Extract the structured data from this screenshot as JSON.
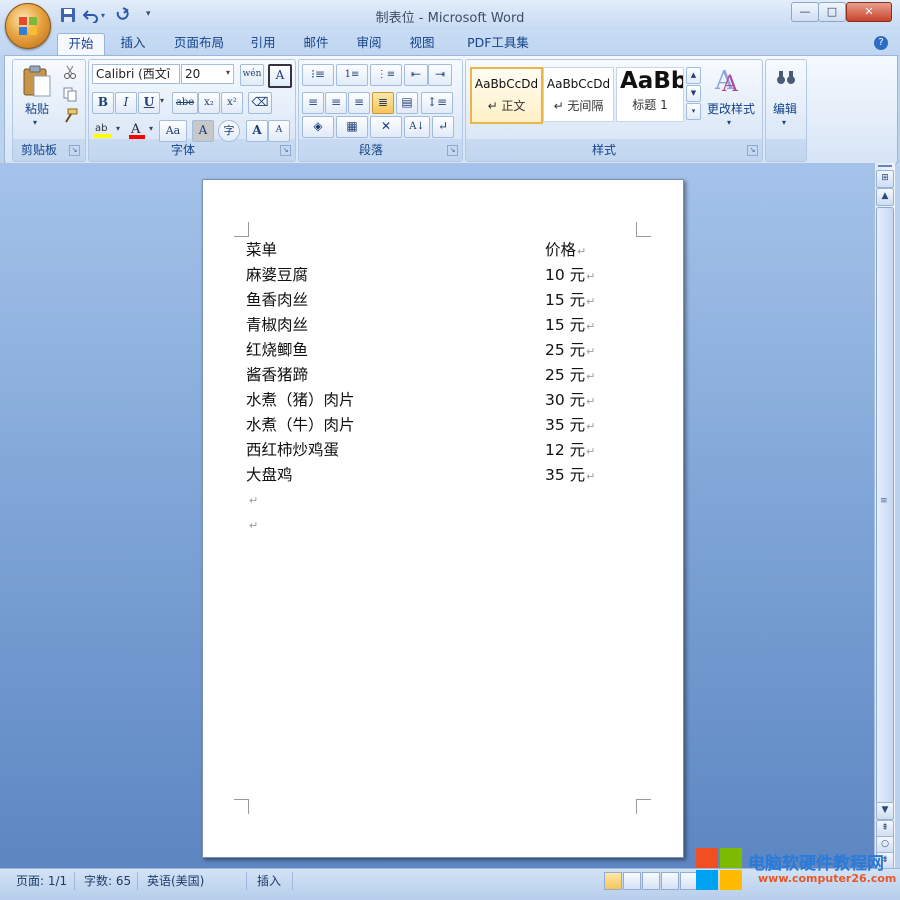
{
  "window": {
    "title": "制表位 - Microsoft Word",
    "minimize": "—",
    "maximize": "□",
    "close": "✕"
  },
  "tabs": [
    "开始",
    "插入",
    "页面布局",
    "引用",
    "邮件",
    "审阅",
    "视图",
    "PDF工具集"
  ],
  "ribbon": {
    "clipboard": {
      "label": "剪贴板",
      "paste": "粘贴"
    },
    "font": {
      "label": "字体",
      "font_name": "Calibri (西文ī",
      "font_size": "20",
      "bold": "B",
      "italic": "I",
      "underline": "U",
      "strike": "abe",
      "subscript": "x₂",
      "superscript": "x²",
      "grow": "A",
      "shrink": "A",
      "case": "Aa",
      "phonetic": "wén",
      "char_border": "A",
      "char_shade": "A",
      "enclose": "字"
    },
    "paragraph": {
      "label": "段落"
    },
    "styles": {
      "label": "样式",
      "items": [
        {
          "sample": "AaBbCcDd",
          "name": "↵ 正文"
        },
        {
          "sample": "AaBbCcDd",
          "name": "↵ 无间隔"
        },
        {
          "sample": "AaBb",
          "name": "标题 1"
        }
      ],
      "change_styles": "更改样式"
    },
    "editing": {
      "label": "编辑"
    }
  },
  "document": {
    "paragraph_mark": "↵",
    "rows": [
      {
        "item": "菜单",
        "price": "价格"
      },
      {
        "item": "麻婆豆腐",
        "price": "10 元"
      },
      {
        "item": "鱼香肉丝",
        "price": "15 元"
      },
      {
        "item": "青椒肉丝",
        "price": "15 元"
      },
      {
        "item": "红烧鲫鱼",
        "price": "25 元"
      },
      {
        "item": "酱香猪蹄",
        "price": "25 元"
      },
      {
        "item": "水煮（猪）肉片",
        "price": "30 元"
      },
      {
        "item": "水煮（牛）肉片",
        "price": "35 元"
      },
      {
        "item": "西红柿炒鸡蛋",
        "price": "12 元"
      },
      {
        "item": "大盘鸡",
        "price": "35 元"
      }
    ]
  },
  "status": {
    "page": "页面: 1/1",
    "words": "字数: 65",
    "language": "英语(美国)",
    "mode": "插入"
  },
  "watermark": {
    "text": "电脑软硬件教程网",
    "url": "www.computer26.com"
  },
  "colors": {
    "accent": "#15428b",
    "ribbon": "#dbe7f7",
    "highlight": "#ffff00",
    "font_color": "#ff0000"
  }
}
